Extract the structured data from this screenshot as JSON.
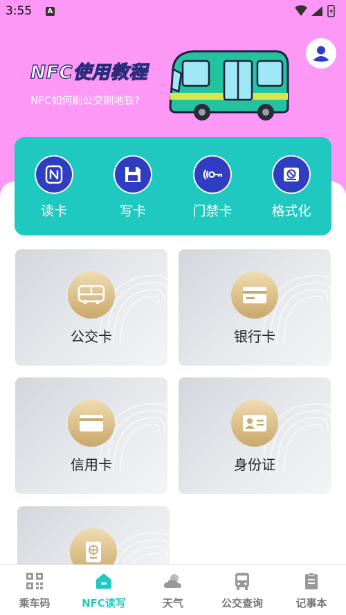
{
  "status_bar": {
    "time": "3:55",
    "badge": "A"
  },
  "header": {
    "title": "NFC使用教程",
    "subtitle": "NFC如何刷公交刷地铁?"
  },
  "tools": [
    {
      "label": "读卡",
      "icon": "nfc-icon"
    },
    {
      "label": "写卡",
      "icon": "floppy-disk-icon"
    },
    {
      "label": "门禁卡",
      "icon": "door-key-icon"
    },
    {
      "label": "格式化",
      "icon": "format-icon"
    }
  ],
  "cards": [
    {
      "label": "公交卡",
      "icon": "bus-icon"
    },
    {
      "label": "银行卡",
      "icon": "bank-card-icon"
    },
    {
      "label": "信用卡",
      "icon": "credit-card-icon"
    },
    {
      "label": "身份证",
      "icon": "id-card-icon"
    },
    {
      "label": "",
      "icon": "passport-icon"
    }
  ],
  "nav": [
    {
      "label": "乘车码",
      "icon": "qr-code-icon",
      "active": false
    },
    {
      "label": "NFC读写",
      "icon": "home-icon",
      "active": true
    },
    {
      "label": "天气",
      "icon": "weather-icon",
      "active": false
    },
    {
      "label": "公交查询",
      "icon": "bus-query-icon",
      "active": false
    },
    {
      "label": "记事本",
      "icon": "notebook-icon",
      "active": false
    }
  ],
  "colors": {
    "hero_bg": "#fd98f6",
    "accent": "#1fc9bf",
    "tool_icon_bg": "#2e3dc2",
    "title_outline": "#2b2d7c",
    "card_icon_gold": "#c9a86a"
  }
}
